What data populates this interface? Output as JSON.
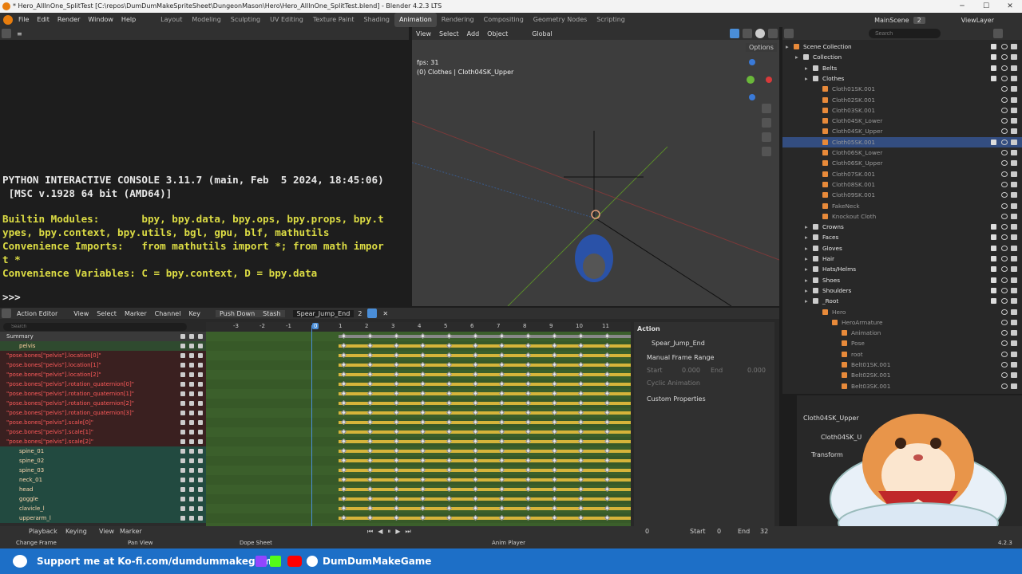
{
  "titlebar": {
    "title": "* Hero_AllInOne_SplitTest [C:\\repos\\DumDumMakeSpriteSheet\\DungeonMason\\Hero\\Hero_AllInOne_SplitTest.blend] - Blender 4.2.3 LTS",
    "minimize": "─",
    "maximize": "☐",
    "close": "✕"
  },
  "menubar": {
    "menus": [
      "File",
      "Edit",
      "Render",
      "Window",
      "Help"
    ],
    "workspaces": [
      "Layout",
      "Modeling",
      "Sculpting",
      "UV Editing",
      "Texture Paint",
      "Shading",
      "Animation",
      "Rendering",
      "Compositing",
      "Geometry Nodes",
      "Scripting"
    ],
    "active_workspace": "Animation",
    "scene": "MainScene",
    "scene_count": "2",
    "view_layer": "ViewLayer"
  },
  "console": {
    "lines": [
      "PYTHON INTERACTIVE CONSOLE 3.11.7 (main, Feb  5 2024, 18:45:06)",
      " [MSC v.1928 64 bit (AMD64)]",
      "",
      "Builtin Modules:       bpy, bpy.data, bpy.ops, bpy.props, bpy.t",
      "ypes, bpy.context, bpy.utils, bgl, gpu, blf, mathutils",
      "Convenience Imports:   from mathutils import *; from math impor",
      "t *",
      "Convenience Variables: C = bpy.context, D = bpy.data"
    ],
    "prompt": ">>> "
  },
  "viewport": {
    "menus": [
      "View",
      "Select",
      "Add",
      "Object"
    ],
    "orientation": "Global",
    "options": "Options",
    "fps": "fps: 31",
    "object_info": "(0) Clothes | Cloth04SK_Upper"
  },
  "outliner": {
    "search_placeholder": "Search",
    "rows": [
      {
        "label": "Scene Collection",
        "indent": 0,
        "kind": "scene"
      },
      {
        "label": "Collection",
        "indent": 1,
        "kind": "coll"
      },
      {
        "label": "Belts",
        "indent": 2,
        "kind": "coll"
      },
      {
        "label": "Clothes",
        "indent": 2,
        "kind": "coll"
      },
      {
        "label": "Cloth01SK.001",
        "indent": 3,
        "kind": "obj"
      },
      {
        "label": "Cloth02SK.001",
        "indent": 3,
        "kind": "obj"
      },
      {
        "label": "Cloth03SK.001",
        "indent": 3,
        "kind": "obj"
      },
      {
        "label": "Cloth04SK_Lower",
        "indent": 3,
        "kind": "obj"
      },
      {
        "label": "Cloth04SK_Upper",
        "indent": 3,
        "kind": "obj"
      },
      {
        "label": "Cloth05SK.001",
        "indent": 3,
        "kind": "obj",
        "selected": true
      },
      {
        "label": "Cloth06SK_Lower",
        "indent": 3,
        "kind": "obj"
      },
      {
        "label": "Cloth06SK_Upper",
        "indent": 3,
        "kind": "obj"
      },
      {
        "label": "Cloth07SK.001",
        "indent": 3,
        "kind": "obj"
      },
      {
        "label": "Cloth08SK.001",
        "indent": 3,
        "kind": "obj"
      },
      {
        "label": "Cloth09SK.001",
        "indent": 3,
        "kind": "obj"
      },
      {
        "label": "FakeNeck",
        "indent": 3,
        "kind": "obj"
      },
      {
        "label": "Knockout Cloth",
        "indent": 3,
        "kind": "obj"
      },
      {
        "label": "Crowns",
        "indent": 2,
        "kind": "coll"
      },
      {
        "label": "Faces",
        "indent": 2,
        "kind": "coll"
      },
      {
        "label": "Gloves",
        "indent": 2,
        "kind": "coll"
      },
      {
        "label": "Hair",
        "indent": 2,
        "kind": "coll"
      },
      {
        "label": "Hats/Helms",
        "indent": 2,
        "kind": "coll"
      },
      {
        "label": "Shoes",
        "indent": 2,
        "kind": "coll"
      },
      {
        "label": "Shoulders",
        "indent": 2,
        "kind": "coll"
      },
      {
        "label": "_Root",
        "indent": 2,
        "kind": "coll"
      },
      {
        "label": "Hero",
        "indent": 3,
        "kind": "obj"
      },
      {
        "label": "HeroArmature",
        "indent": 4,
        "kind": "obj"
      },
      {
        "label": "Animation",
        "indent": 5,
        "kind": "obj"
      },
      {
        "label": "Pose",
        "indent": 5,
        "kind": "obj"
      },
      {
        "label": "root",
        "indent": 5,
        "kind": "obj"
      },
      {
        "label": "Belt01SK.001",
        "indent": 5,
        "kind": "obj"
      },
      {
        "label": "Belt02SK.001",
        "indent": 5,
        "kind": "obj"
      },
      {
        "label": "Belt03SK.001",
        "indent": 5,
        "kind": "obj"
      }
    ]
  },
  "properties": {
    "object": "Cloth04SK_Upper",
    "object2": "Cloth04SK_U",
    "transform": "Transform"
  },
  "action_editor": {
    "mode": "Action Editor",
    "menus": [
      "View",
      "Select",
      "Marker",
      "Channel",
      "Key"
    ],
    "push_down": "Push Down",
    "stash": "Stash",
    "action_name": "Spear_Jump_End",
    "action_users": "2",
    "search_placeholder": "Search",
    "frame_numbers": [
      "-3",
      "-2",
      "-1",
      "0",
      "1",
      "2",
      "3",
      "4",
      "5",
      "6",
      "7",
      "8",
      "9",
      "10",
      "11"
    ],
    "current_frame": "0",
    "channels": [
      {
        "label": "Summary",
        "kind": "summary"
      },
      {
        "label": "pelvis",
        "kind": "group"
      },
      {
        "label": "\"pose.bones[\"pelvis\"].location[0]\"",
        "kind": "red"
      },
      {
        "label": "\"pose.bones[\"pelvis\"].location[1]\"",
        "kind": "red"
      },
      {
        "label": "\"pose.bones[\"pelvis\"].location[2]\"",
        "kind": "red"
      },
      {
        "label": "\"pose.bones[\"pelvis\"].rotation_quaternion[0]\"",
        "kind": "red"
      },
      {
        "label": "\"pose.bones[\"pelvis\"].rotation_quaternion[1]\"",
        "kind": "red"
      },
      {
        "label": "\"pose.bones[\"pelvis\"].rotation_quaternion[2]\"",
        "kind": "red"
      },
      {
        "label": "\"pose.bones[\"pelvis\"].rotation_quaternion[3]\"",
        "kind": "red"
      },
      {
        "label": "\"pose.bones[\"pelvis\"].scale[0]\"",
        "kind": "red"
      },
      {
        "label": "\"pose.bones[\"pelvis\"].scale[1]\"",
        "kind": "red"
      },
      {
        "label": "\"pose.bones[\"pelvis\"].scale[2]\"",
        "kind": "red"
      },
      {
        "label": "spine_01",
        "kind": "bone"
      },
      {
        "label": "spine_02",
        "kind": "bone"
      },
      {
        "label": "spine_03",
        "kind": "bone"
      },
      {
        "label": "neck_01",
        "kind": "bone"
      },
      {
        "label": "head",
        "kind": "bone"
      },
      {
        "label": "goggle",
        "kind": "bone"
      },
      {
        "label": "clavicle_l",
        "kind": "bone"
      },
      {
        "label": "upperarm_l",
        "kind": "bone"
      }
    ],
    "panel": {
      "tab": "Action",
      "action_name": "Spear_Jump_End",
      "manual_range": "Manual Frame Range",
      "start_label": "Start",
      "start_val": "0.000",
      "end_label": "End",
      "end_val": "0.000",
      "cyclic": "Cyclic Animation",
      "custom_props": "Custom Properties"
    }
  },
  "timeline": {
    "playback": "Playback",
    "keying": "Keying",
    "view": "View",
    "marker": "Marker",
    "current": "0",
    "start_label": "Start",
    "start": "0",
    "end_label": "End",
    "end": "32"
  },
  "statusbar": {
    "change_frame": "Change Frame",
    "pan_view": "Pan View",
    "dope_sheet": "Dope Sheet",
    "anim_player": "Anim Player",
    "version": "4.2.3"
  },
  "promo": {
    "kofi": "Support me at Ko-fi.com/dumdummakegame",
    "channel": "DumDumMakeGame"
  },
  "colors": {
    "accent_blue": "#4a8ed8",
    "key_yellow": "#d6b43a",
    "red_channel": "#ff5a5a",
    "promo_blue": "#1d6fc7"
  }
}
